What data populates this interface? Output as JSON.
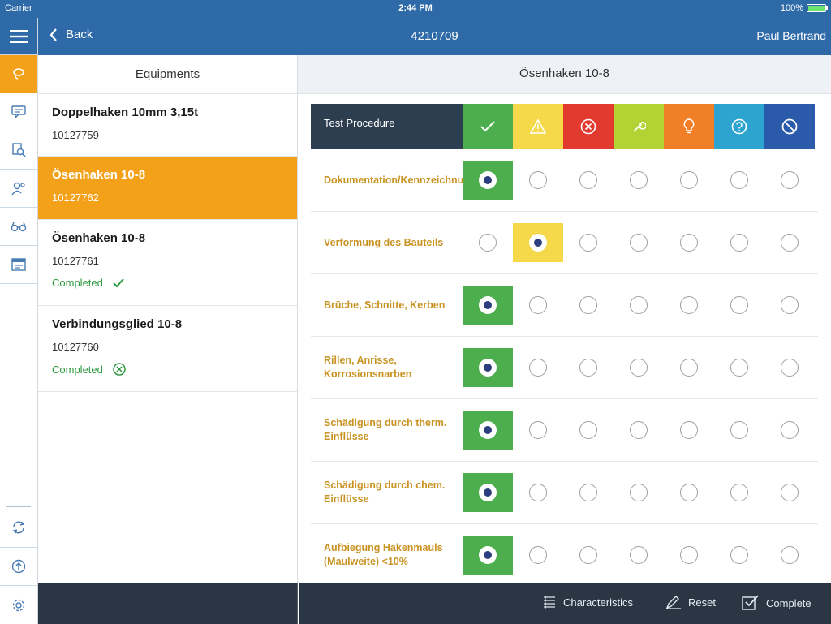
{
  "status_bar": {
    "carrier": "Carrier",
    "time": "2:44 PM",
    "battery": "100%"
  },
  "nav": {
    "back_label": "Back",
    "title": "4210709",
    "user": "Paul Bertrand"
  },
  "rail": {
    "items": [
      {
        "icon": "lasso-icon",
        "active": true
      },
      {
        "icon": "message-icon",
        "active": false
      },
      {
        "icon": "search-document-icon",
        "active": false
      },
      {
        "icon": "user-settings-icon",
        "active": false
      },
      {
        "icon": "glasses-icon",
        "active": false
      },
      {
        "icon": "form-icon",
        "active": false
      }
    ],
    "bottom_items": [
      {
        "icon": "sync-icon"
      },
      {
        "icon": "upload-icon"
      },
      {
        "icon": "settings-icon"
      }
    ]
  },
  "equipments": {
    "header": "Equipments",
    "items": [
      {
        "name": "Doppelhaken 10mm 3,15t",
        "number": "10127759",
        "status": "",
        "selected": false
      },
      {
        "name": "Ösenhaken 10-8",
        "number": "10127762",
        "status": "",
        "selected": true
      },
      {
        "name": "Ösenhaken 10-8",
        "number": "10127761",
        "status": "Completed",
        "status_icon": "check-icon",
        "selected": false
      },
      {
        "name": "Verbindungsglied 10-8",
        "number": "10127760",
        "status": "Completed",
        "status_icon": "error-circle-icon",
        "selected": false
      }
    ]
  },
  "detail": {
    "header": "Ösenhaken 10-8",
    "procedure_label": "Test Procedure",
    "columns": [
      {
        "icon": "check-icon",
        "color": "#4cae4c"
      },
      {
        "icon": "warning-icon",
        "color": "#f5d94b"
      },
      {
        "icon": "cancel-circle-icon",
        "color": "#e23a2f"
      },
      {
        "icon": "wrench-icon",
        "color": "#b3d334"
      },
      {
        "icon": "bulb-icon",
        "color": "#f07f27"
      },
      {
        "icon": "help-circle-icon",
        "color": "#2da3cf"
      },
      {
        "icon": "blocked-icon",
        "color": "#2a5aa9"
      }
    ],
    "rows": [
      {
        "label": "Dokumentation/Kennzeichnung",
        "selected": 0
      },
      {
        "label": "Verformung des Bauteils",
        "selected": 1
      },
      {
        "label": "Brüche, Schnitte, Kerben",
        "selected": 0
      },
      {
        "label": "Rillen, Anrisse, Korrosionsnarben",
        "selected": 0
      },
      {
        "label": "Schädigung durch therm. Einflüsse",
        "selected": 0
      },
      {
        "label": "Schädigung durch chem. Einflüsse",
        "selected": 0
      },
      {
        "label": "Aufbiegung Hakenmauls (Maulweite) <10%",
        "selected": 0
      }
    ]
  },
  "actions": {
    "characteristics": "Characteristics",
    "reset": "Reset",
    "complete": "Complete"
  }
}
